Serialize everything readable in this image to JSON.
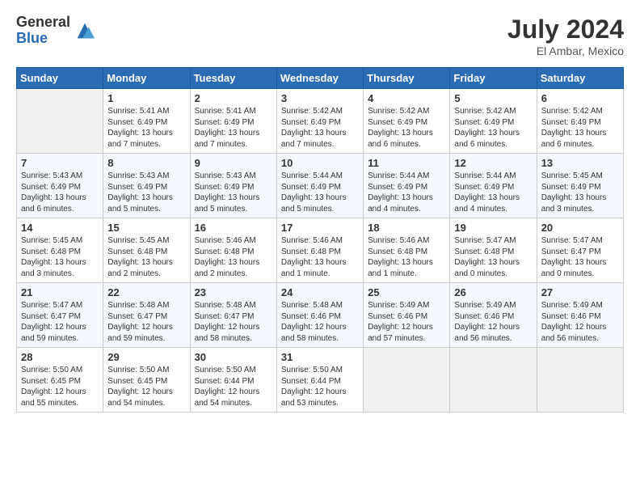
{
  "logo": {
    "general": "General",
    "blue": "Blue"
  },
  "title": {
    "month_year": "July 2024",
    "location": "El Ambar, Mexico"
  },
  "weekdays": [
    "Sunday",
    "Monday",
    "Tuesday",
    "Wednesday",
    "Thursday",
    "Friday",
    "Saturday"
  ],
  "weeks": [
    [
      {
        "day": "",
        "empty": true
      },
      {
        "day": "1",
        "sunrise": "Sunrise: 5:41 AM",
        "sunset": "Sunset: 6:49 PM",
        "daylight": "Daylight: 13 hours and 7 minutes."
      },
      {
        "day": "2",
        "sunrise": "Sunrise: 5:41 AM",
        "sunset": "Sunset: 6:49 PM",
        "daylight": "Daylight: 13 hours and 7 minutes."
      },
      {
        "day": "3",
        "sunrise": "Sunrise: 5:42 AM",
        "sunset": "Sunset: 6:49 PM",
        "daylight": "Daylight: 13 hours and 7 minutes."
      },
      {
        "day": "4",
        "sunrise": "Sunrise: 5:42 AM",
        "sunset": "Sunset: 6:49 PM",
        "daylight": "Daylight: 13 hours and 6 minutes."
      },
      {
        "day": "5",
        "sunrise": "Sunrise: 5:42 AM",
        "sunset": "Sunset: 6:49 PM",
        "daylight": "Daylight: 13 hours and 6 minutes."
      },
      {
        "day": "6",
        "sunrise": "Sunrise: 5:42 AM",
        "sunset": "Sunset: 6:49 PM",
        "daylight": "Daylight: 13 hours and 6 minutes."
      }
    ],
    [
      {
        "day": "7",
        "sunrise": "Sunrise: 5:43 AM",
        "sunset": "Sunset: 6:49 PM",
        "daylight": "Daylight: 13 hours and 6 minutes."
      },
      {
        "day": "8",
        "sunrise": "Sunrise: 5:43 AM",
        "sunset": "Sunset: 6:49 PM",
        "daylight": "Daylight: 13 hours and 5 minutes."
      },
      {
        "day": "9",
        "sunrise": "Sunrise: 5:43 AM",
        "sunset": "Sunset: 6:49 PM",
        "daylight": "Daylight: 13 hours and 5 minutes."
      },
      {
        "day": "10",
        "sunrise": "Sunrise: 5:44 AM",
        "sunset": "Sunset: 6:49 PM",
        "daylight": "Daylight: 13 hours and 5 minutes."
      },
      {
        "day": "11",
        "sunrise": "Sunrise: 5:44 AM",
        "sunset": "Sunset: 6:49 PM",
        "daylight": "Daylight: 13 hours and 4 minutes."
      },
      {
        "day": "12",
        "sunrise": "Sunrise: 5:44 AM",
        "sunset": "Sunset: 6:49 PM",
        "daylight": "Daylight: 13 hours and 4 minutes."
      },
      {
        "day": "13",
        "sunrise": "Sunrise: 5:45 AM",
        "sunset": "Sunset: 6:49 PM",
        "daylight": "Daylight: 13 hours and 3 minutes."
      }
    ],
    [
      {
        "day": "14",
        "sunrise": "Sunrise: 5:45 AM",
        "sunset": "Sunset: 6:48 PM",
        "daylight": "Daylight: 13 hours and 3 minutes."
      },
      {
        "day": "15",
        "sunrise": "Sunrise: 5:45 AM",
        "sunset": "Sunset: 6:48 PM",
        "daylight": "Daylight: 13 hours and 2 minutes."
      },
      {
        "day": "16",
        "sunrise": "Sunrise: 5:46 AM",
        "sunset": "Sunset: 6:48 PM",
        "daylight": "Daylight: 13 hours and 2 minutes."
      },
      {
        "day": "17",
        "sunrise": "Sunrise: 5:46 AM",
        "sunset": "Sunset: 6:48 PM",
        "daylight": "Daylight: 13 hours and 1 minute."
      },
      {
        "day": "18",
        "sunrise": "Sunrise: 5:46 AM",
        "sunset": "Sunset: 6:48 PM",
        "daylight": "Daylight: 13 hours and 1 minute."
      },
      {
        "day": "19",
        "sunrise": "Sunrise: 5:47 AM",
        "sunset": "Sunset: 6:48 PM",
        "daylight": "Daylight: 13 hours and 0 minutes."
      },
      {
        "day": "20",
        "sunrise": "Sunrise: 5:47 AM",
        "sunset": "Sunset: 6:47 PM",
        "daylight": "Daylight: 13 hours and 0 minutes."
      }
    ],
    [
      {
        "day": "21",
        "sunrise": "Sunrise: 5:47 AM",
        "sunset": "Sunset: 6:47 PM",
        "daylight": "Daylight: 12 hours and 59 minutes."
      },
      {
        "day": "22",
        "sunrise": "Sunrise: 5:48 AM",
        "sunset": "Sunset: 6:47 PM",
        "daylight": "Daylight: 12 hours and 59 minutes."
      },
      {
        "day": "23",
        "sunrise": "Sunrise: 5:48 AM",
        "sunset": "Sunset: 6:47 PM",
        "daylight": "Daylight: 12 hours and 58 minutes."
      },
      {
        "day": "24",
        "sunrise": "Sunrise: 5:48 AM",
        "sunset": "Sunset: 6:46 PM",
        "daylight": "Daylight: 12 hours and 58 minutes."
      },
      {
        "day": "25",
        "sunrise": "Sunrise: 5:49 AM",
        "sunset": "Sunset: 6:46 PM",
        "daylight": "Daylight: 12 hours and 57 minutes."
      },
      {
        "day": "26",
        "sunrise": "Sunrise: 5:49 AM",
        "sunset": "Sunset: 6:46 PM",
        "daylight": "Daylight: 12 hours and 56 minutes."
      },
      {
        "day": "27",
        "sunrise": "Sunrise: 5:49 AM",
        "sunset": "Sunset: 6:46 PM",
        "daylight": "Daylight: 12 hours and 56 minutes."
      }
    ],
    [
      {
        "day": "28",
        "sunrise": "Sunrise: 5:50 AM",
        "sunset": "Sunset: 6:45 PM",
        "daylight": "Daylight: 12 hours and 55 minutes."
      },
      {
        "day": "29",
        "sunrise": "Sunrise: 5:50 AM",
        "sunset": "Sunset: 6:45 PM",
        "daylight": "Daylight: 12 hours and 54 minutes."
      },
      {
        "day": "30",
        "sunrise": "Sunrise: 5:50 AM",
        "sunset": "Sunset: 6:44 PM",
        "daylight": "Daylight: 12 hours and 54 minutes."
      },
      {
        "day": "31",
        "sunrise": "Sunrise: 5:50 AM",
        "sunset": "Sunset: 6:44 PM",
        "daylight": "Daylight: 12 hours and 53 minutes."
      },
      {
        "day": "",
        "empty": true
      },
      {
        "day": "",
        "empty": true
      },
      {
        "day": "",
        "empty": true
      }
    ]
  ]
}
